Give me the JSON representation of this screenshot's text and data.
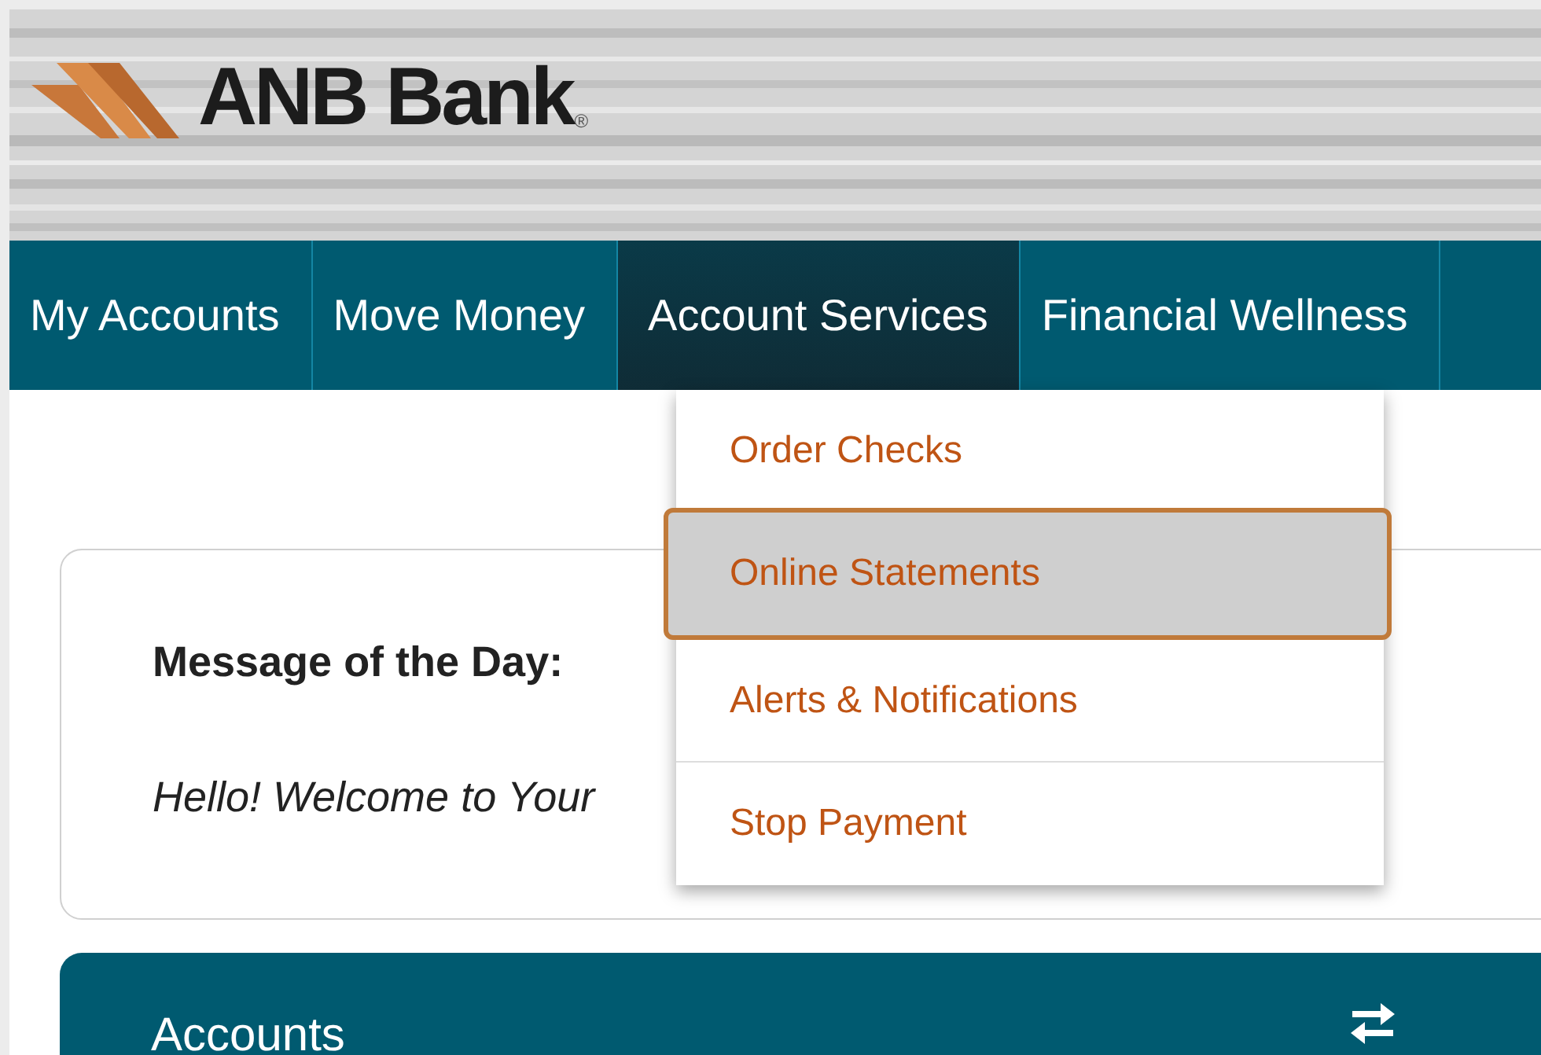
{
  "header": {
    "logo": {
      "name": "ANB Bank",
      "mark": "®"
    }
  },
  "nav": {
    "tabs": [
      {
        "label": "My Accounts",
        "selected": false
      },
      {
        "label": "Move Money",
        "selected": false
      },
      {
        "label": "Account Services",
        "selected": true
      },
      {
        "label": "Financial Wellness",
        "selected": false
      }
    ]
  },
  "dropdown": {
    "items": [
      {
        "label": "Order Checks",
        "selected": false
      },
      {
        "label": "Online Statements",
        "selected": true
      },
      {
        "label": "Alerts & Notifications",
        "selected": false
      },
      {
        "label": "Stop Payment",
        "selected": false
      }
    ]
  },
  "message": {
    "title": "Message of the Day:",
    "text": "Hello! Welcome to Your"
  },
  "accounts_panel": {
    "title": "Accounts"
  }
}
